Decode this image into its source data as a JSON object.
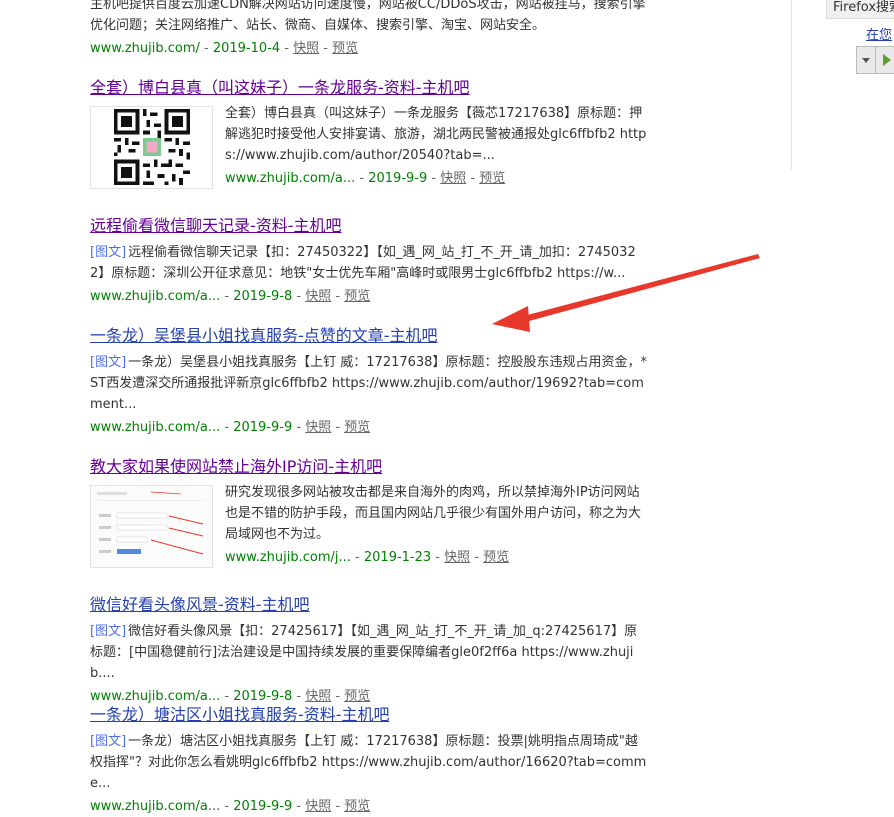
{
  "results": [
    {
      "abstract": "主机吧提供百度云加速CDN解决网站访问速度慢，网站被CC/DDoS攻击，网站被挂马，搜索引擎优化问题；关注网络推广、站长、微商、自媒体、搜索引擎、淘宝、网站安全。",
      "url": "www.zhujib.com/",
      "date": "2019-10-4"
    },
    {
      "title": "全套）博白县真（叫这妹子）一条龙服务-资料-主机吧",
      "abstract": "全套）博白县真（叫这妹子）一条龙服务【薇芯17217638】原标题：押解逃犯时接受他人安排宴请、旅游，湖北两民警被通报处glc6ffbfb2 https://www.zhujib.com/author/20540?tab=...",
      "url": "www.zhujib.com/a...",
      "date": "2019-9-9"
    },
    {
      "title": "远程偷看微信聊天记录-资料-主机吧",
      "tag": "[图文]",
      "abstract": "远程偷看微信聊天记录【扣：27450322】【如_遇_网_站_打_不_开_请_加扣：27450322】原标题：深圳公开征求意见：地铁\"女士优先车厢\"高峰时或限男士glc6ffbfb2 https://w...",
      "url": "www.zhujib.com/a...",
      "date": "2019-9-8"
    },
    {
      "title": "一条龙）吴堡县小姐找真服务-点赞的文章-主机吧",
      "tag": "[图文]",
      "abstract": "一条龙）吴堡县小姐找真服务【上钉 威：17217638】原标题：控股股东违规占用资金，*ST西发遭深交所通报批评新京glc6ffbfb2 https://www.zhujib.com/author/19692?tab=comment...",
      "url": "www.zhujib.com/a...",
      "date": "2019-9-9"
    },
    {
      "title": "教大家如果使网站禁止海外IP访问-主机吧",
      "abstract": "研究发现很多网站被攻击都是来自海外的肉鸡，所以禁掉海外IP访问网站也是不错的防护手段，而且国内网站几乎很少有国外用户访问，称之为大局域网也不为过。",
      "url": "www.zhujib.com/j...",
      "date": "2019-1-23"
    },
    {
      "title": "微信好看头像风景-资料-主机吧",
      "tag": "[图文]",
      "abstract": "微信好看头像风景【扣：27425617】【如_遇_网_站_打_不_开_请_加_q:27425617】原标题：[中国稳健前行]法治建设是中国持续发展的重要保障编者gle0f2ff6a https://www.zhujib....",
      "url": "www.zhujib.com/a...",
      "date": "2019-9-8"
    },
    {
      "title": "一条龙）塘沽区小姐找真服务-资料-主机吧",
      "tag": "[图文]",
      "abstract": "一条龙）塘沽区小姐找真服务【上钉 威：17217638】原标题：投票|姚明指点周琦成\"越权指挥\"？对此你怎么看姚明glc6ffbfb2 https://www.zhujib.com/author/16620?tab=comme...",
      "url": "www.zhujib.com/a...",
      "date": "2019-9-9"
    }
  ],
  "labels": {
    "kuaizhao": "快照",
    "yulan": "预览",
    "dash": " - "
  },
  "sidebar": {
    "firefox_label": "Firefox搜索",
    "zai_link": "在您"
  },
  "colors": {
    "title_link": "#2440b3",
    "title_visited": "#660099",
    "url_green": "#008000",
    "tag_blue": "#4e6ef2",
    "arrow_red": "#e8372b"
  }
}
